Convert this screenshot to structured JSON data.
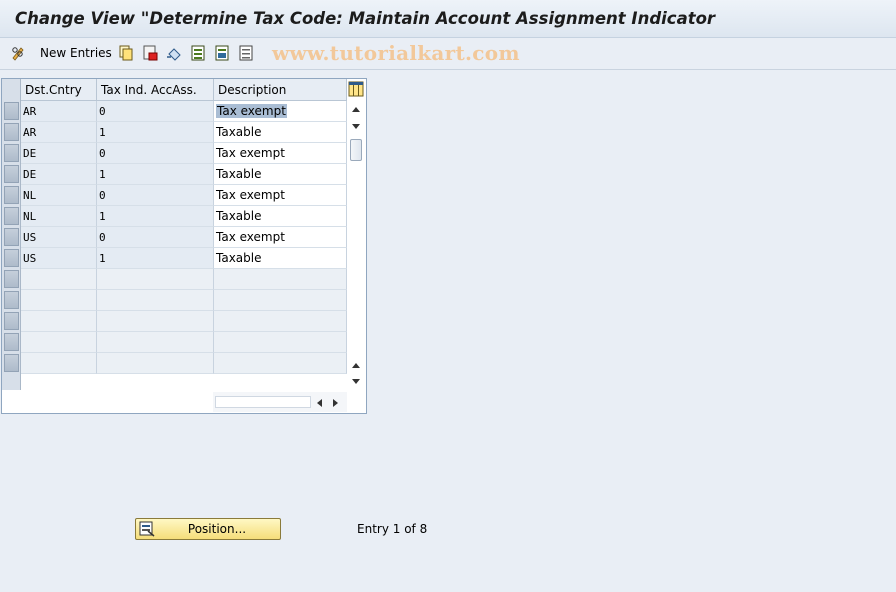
{
  "window": {
    "title": "Change View \"Determine Tax Code: Maintain Account Assignment Indicator"
  },
  "toolbar": {
    "new_entries_label": "New Entries",
    "watermark": "www.tutorialkart.com",
    "icons": [
      "pencil-glasses-icon",
      "copy-icon",
      "delete-icon",
      "undo-icon",
      "select-all-icon",
      "select-block-icon",
      "deselect-icon"
    ]
  },
  "table": {
    "columns": [
      "Dst.Cntry",
      "Tax Ind. AccAss.",
      "Description"
    ],
    "rows": [
      {
        "country": "AR",
        "indicator": "0",
        "description": "Tax exempt"
      },
      {
        "country": "AR",
        "indicator": "1",
        "description": "Taxable"
      },
      {
        "country": "DE",
        "indicator": "0",
        "description": "Tax exempt"
      },
      {
        "country": "DE",
        "indicator": "1",
        "description": "Taxable"
      },
      {
        "country": "NL",
        "indicator": "0",
        "description": "Tax exempt"
      },
      {
        "country": "NL",
        "indicator": "1",
        "description": "Taxable"
      },
      {
        "country": "US",
        "indicator": "0",
        "description": "Tax exempt"
      },
      {
        "country": "US",
        "indicator": "1",
        "description": "Taxable"
      }
    ]
  },
  "footer": {
    "position_label": "Position...",
    "entry_text": "Entry 1 of 8"
  },
  "colors": {
    "title_bg": "#dde6f0",
    "body_bg": "#e9eef5",
    "key_cell_bg": "#e4ebf3",
    "selection": "#a9bdd4",
    "button_yellow": "#f5dd7a",
    "watermark": "#f2c89a"
  }
}
